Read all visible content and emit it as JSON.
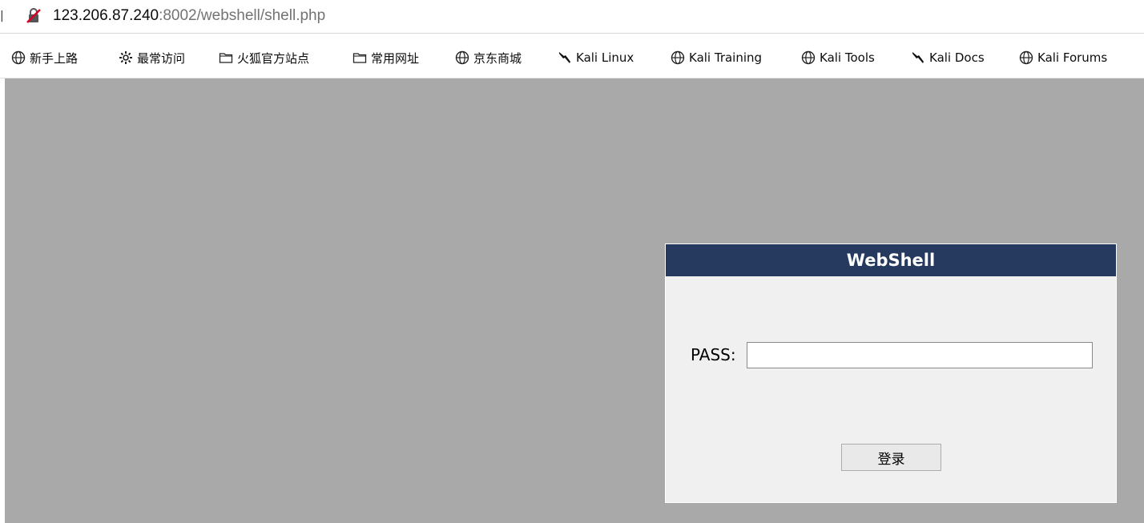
{
  "address_bar": {
    "url_host": "123.206.87.240",
    "url_rest": ":8002/webshell/shell.php",
    "security_icon": "insecure-lock-icon"
  },
  "bookmarks": [
    {
      "label": "新手上路",
      "icon": "globe-icon"
    },
    {
      "label": "最常访问",
      "icon": "gear-icon"
    },
    {
      "label": "火狐官方站点",
      "icon": "folder-icon"
    },
    {
      "label": "常用网址",
      "icon": "folder-icon"
    },
    {
      "label": "京东商城",
      "icon": "globe-icon"
    },
    {
      "label": "Kali Linux",
      "icon": "kali-dragon-icon"
    },
    {
      "label": "Kali Training",
      "icon": "globe-icon"
    },
    {
      "label": "Kali Tools",
      "icon": "globe-icon"
    },
    {
      "label": "Kali Docs",
      "icon": "kali-dragon-icon"
    },
    {
      "label": "Kali Forums",
      "icon": "globe-icon"
    }
  ],
  "login_panel": {
    "title": "WebShell",
    "pass_label": "PASS:",
    "pass_value": "",
    "login_button": "登录"
  },
  "colors": {
    "page_background": "#a9a9a9",
    "panel_title_bg": "#253a5e",
    "panel_bg": "#f0f0f0"
  }
}
